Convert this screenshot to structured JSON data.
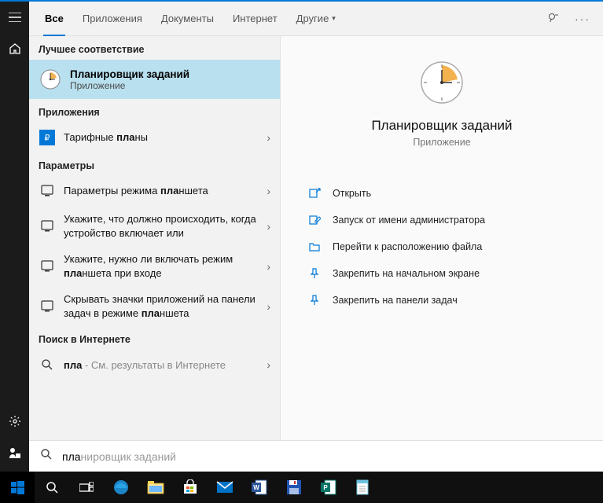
{
  "tabs": {
    "all": "Все",
    "apps": "Приложения",
    "docs": "Документы",
    "web": "Интернет",
    "more": "Другие"
  },
  "sections": {
    "best_match": "Лучшее соответствие",
    "apps": "Приложения",
    "settings": "Параметры",
    "internet": "Поиск в Интернете"
  },
  "best_match": {
    "title": "Планировщик заданий",
    "subtitle": "Приложение"
  },
  "app_results": [
    {
      "title_pre": "Тарифные ",
      "title_hl": "пла",
      "title_post": "ны"
    }
  ],
  "settings_results": [
    {
      "text_pre": "Параметры режима ",
      "text_hl": "пла",
      "text_post": "ншета"
    },
    {
      "text_pre": "Укажите, что должно происходить, когда устройство включает или",
      "text_hl": "",
      "text_post": ""
    },
    {
      "text_pre": "Укажите, нужно ли включать режим ",
      "text_hl": "пла",
      "text_post": "ншета при входе"
    },
    {
      "text_pre": "Скрывать значки приложений на панели задач в режиме ",
      "text_hl": "пла",
      "text_post": "ншета"
    }
  ],
  "web_result": {
    "query": "пла",
    "suffix": " - См. результаты в Интернете"
  },
  "preview": {
    "title": "Планировщик заданий",
    "subtitle": "Приложение"
  },
  "actions": {
    "open": "Открыть",
    "run_admin": "Запуск от имени администратора",
    "file_location": "Перейти к расположению файла",
    "pin_start": "Закрепить на начальном экране",
    "pin_taskbar": "Закрепить на панели задач"
  },
  "search": {
    "typed": "пла",
    "ghost": "нировщик заданий"
  }
}
